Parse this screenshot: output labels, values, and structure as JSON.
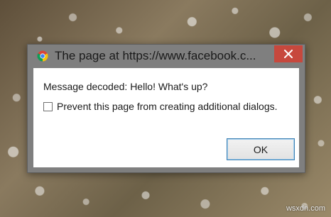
{
  "dialog": {
    "title": "The page at https://www.facebook.c...",
    "message": "Message decoded: Hello! What's up?",
    "prevent_label": "Prevent this page from creating additional dialogs.",
    "prevent_checked": false,
    "ok_label": "OK",
    "close_icon": "close-icon",
    "browser_icon": "chrome-icon"
  },
  "watermark": "wsxdn.com",
  "colors": {
    "titlebar": "#7f7f7f",
    "close_button": "#c7483d",
    "ok_border": "#3c7fb1",
    "content_bg": "#ffffff"
  }
}
